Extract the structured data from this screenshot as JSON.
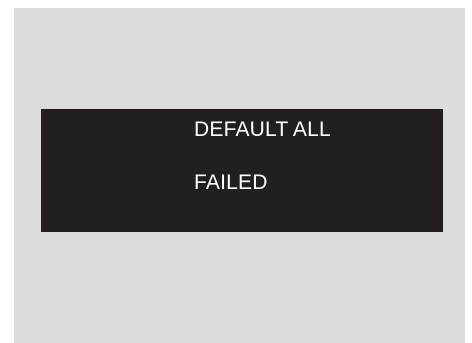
{
  "display": {
    "background_color": "#dcdcde",
    "panel_color": "#231f20",
    "text_color": "#ffffff",
    "message_line_1": "DEFAULT ALL",
    "message_line_2": "FAILED"
  }
}
